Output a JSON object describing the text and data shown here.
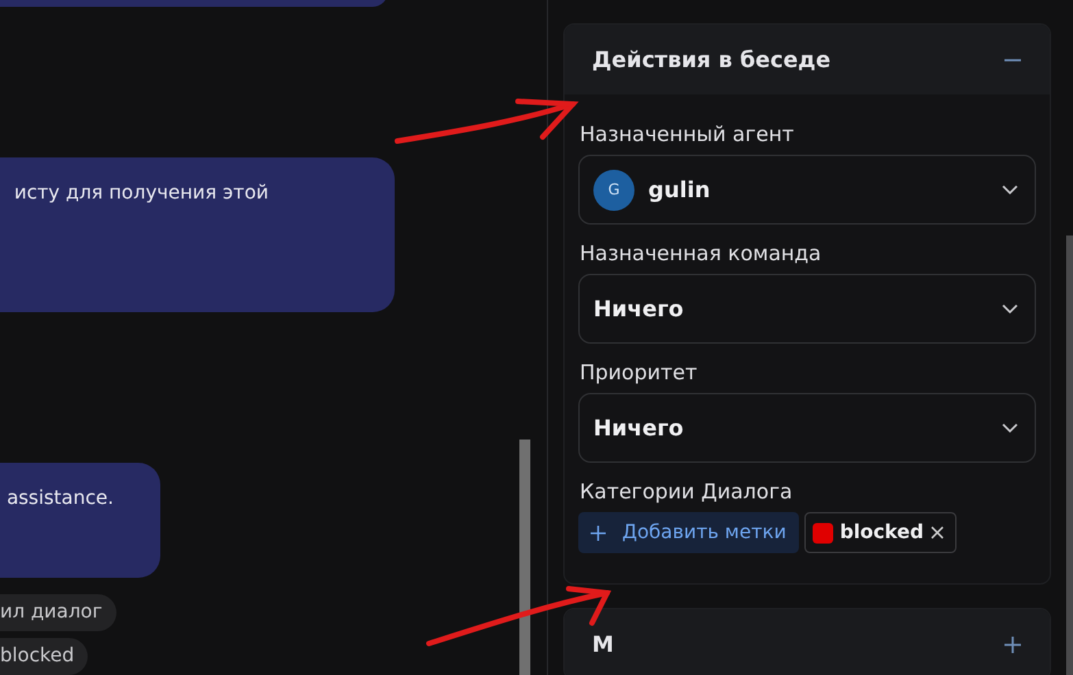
{
  "chat": {
    "messages": [
      {
        "kind": "bubble"
      },
      {
        "kind": "bubble",
        "text": "исту для получения этой"
      },
      {
        "kind": "bubble",
        "text": "assistance."
      },
      {
        "kind": "event",
        "text": "ил диалог"
      },
      {
        "kind": "event",
        "text": "blocked"
      }
    ]
  },
  "panel": {
    "section": {
      "title": "Действия в беседе",
      "expanded": true,
      "fields": [
        {
          "kind": "agent",
          "label": "Назначенный агент",
          "avatar": "G",
          "value": "gulin"
        },
        {
          "kind": "select",
          "label": "Назначенная команда",
          "value": "Ничего"
        },
        {
          "kind": "select",
          "label": "Приоритет",
          "value": "Ничего"
        },
        {
          "kind": "tags",
          "label": "Категории Диалога",
          "add_label": "Добавить метки",
          "tags": [
            {
              "label": "blocked",
              "color": "#e00000"
            }
          ]
        }
      ]
    },
    "next_section": {
      "title": "М",
      "expanded": false
    }
  }
}
